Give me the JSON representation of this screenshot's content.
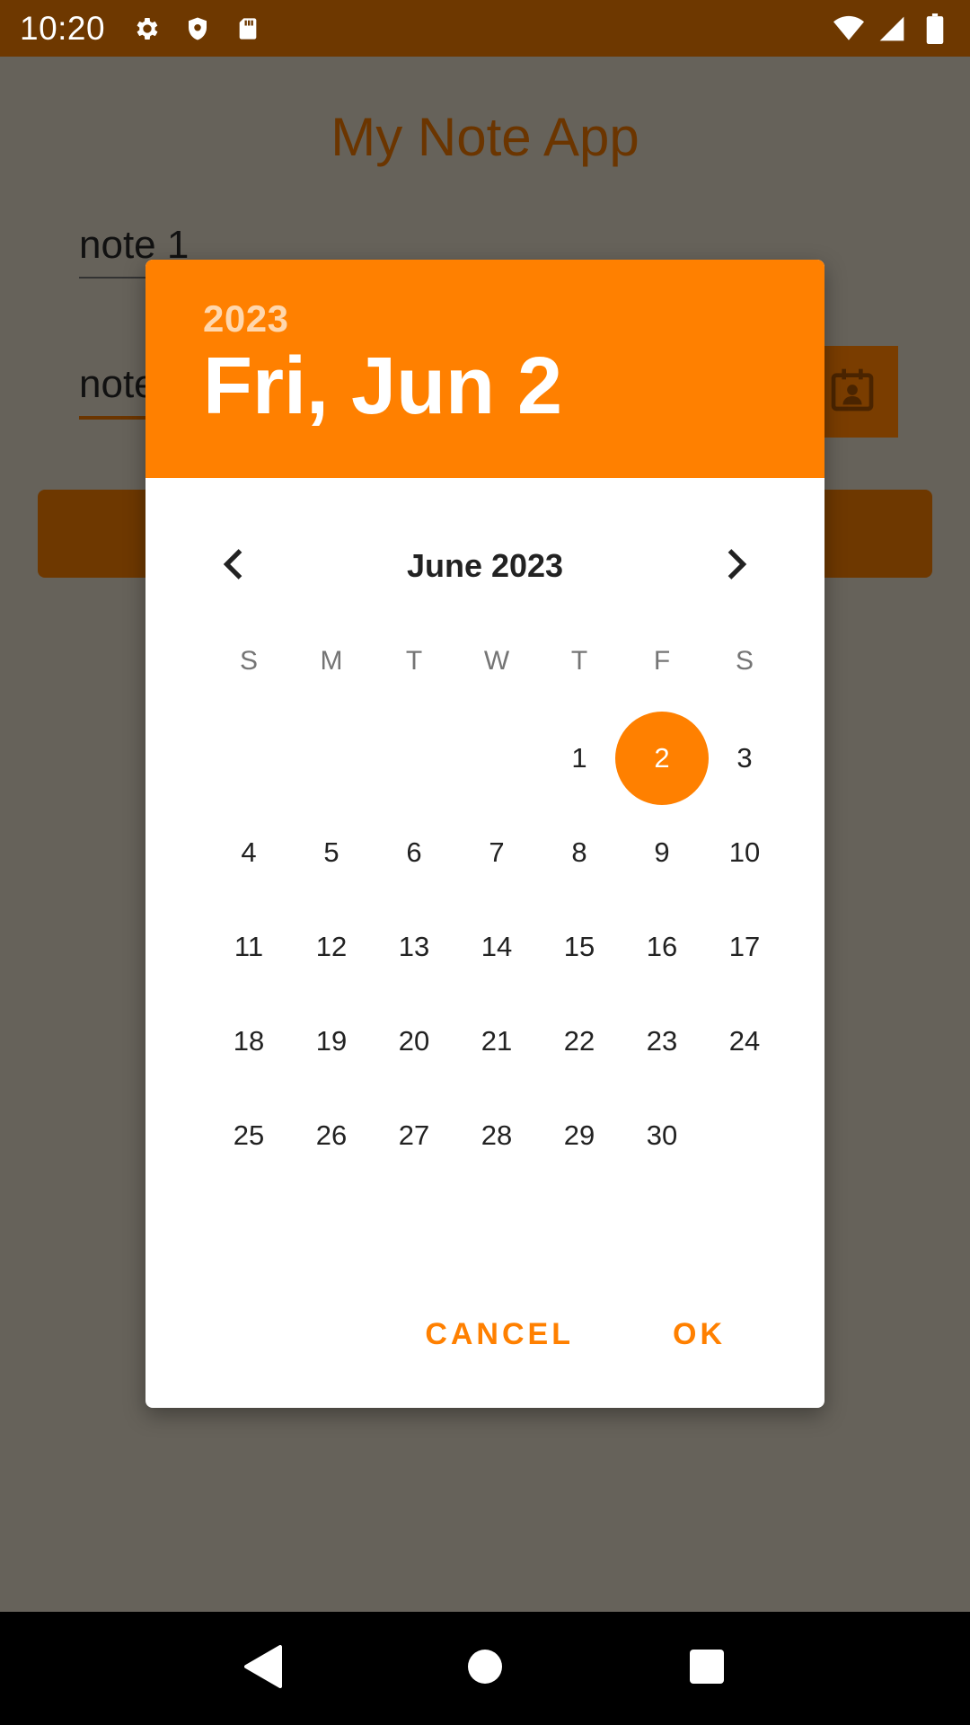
{
  "status_bar": {
    "time": "10:20",
    "left_icons": [
      "gear-icon",
      "shield-icon",
      "sd-card-icon"
    ],
    "right_icons": [
      "wifi-icon",
      "signal-icon",
      "battery-icon"
    ]
  },
  "app": {
    "title": "My Note App",
    "note1_value": "note 1",
    "note2_value": "note",
    "accent_color": "#6b3500"
  },
  "date_picker": {
    "header_year": "2023",
    "header_date": "Fri, Jun 2",
    "month_label": "June 2023",
    "weekdays": [
      "S",
      "M",
      "T",
      "W",
      "T",
      "F",
      "S"
    ],
    "days": [
      "",
      "",
      "",
      "",
      "1",
      "2",
      "3",
      "4",
      "5",
      "6",
      "7",
      "8",
      "9",
      "10",
      "11",
      "12",
      "13",
      "14",
      "15",
      "16",
      "17",
      "18",
      "19",
      "20",
      "21",
      "22",
      "23",
      "24",
      "25",
      "26",
      "27",
      "28",
      "29",
      "30",
      ""
    ],
    "selected_day": "2",
    "cancel_label": "CANCEL",
    "ok_label": "OK",
    "accent_color": "#ff8000"
  },
  "nav_bar": {
    "buttons": [
      "back-icon",
      "home-icon",
      "recents-icon"
    ]
  }
}
